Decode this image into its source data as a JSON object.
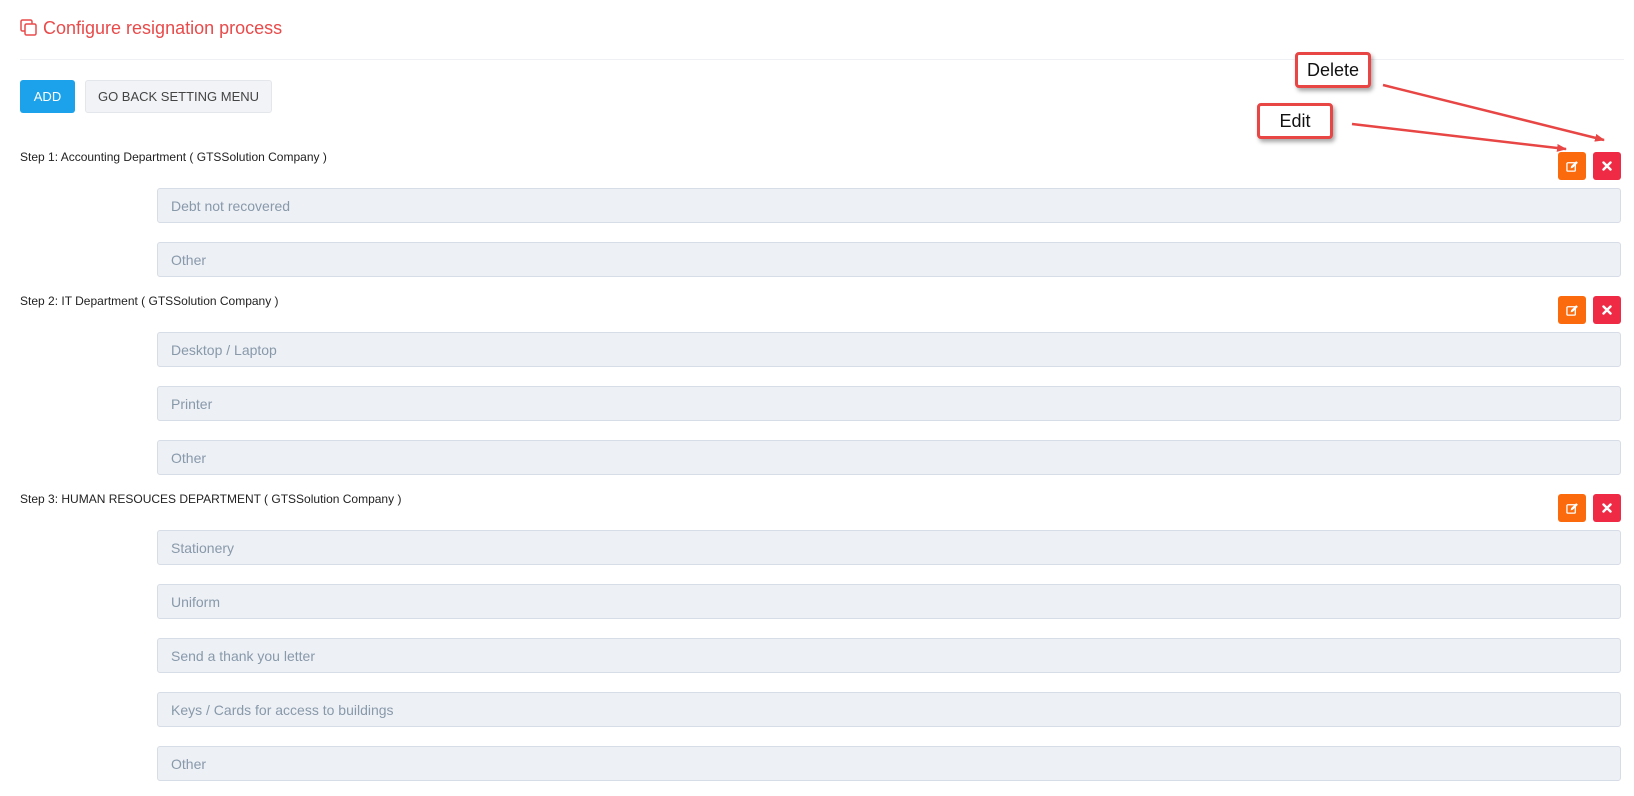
{
  "header": {
    "title": "Configure resignation process",
    "icon": "copy-icon",
    "title_color": "#e94a4a"
  },
  "toolbar": {
    "add_label": "ADD",
    "back_label": "GO BACK SETTING MENU",
    "add_color": "#1ba2eb"
  },
  "steps": [
    {
      "title": "Step 1: Accounting Department ( GTSSolution Company )",
      "items": [
        "Debt not recovered",
        "Other"
      ]
    },
    {
      "title": "Step 2: IT Department ( GTSSolution Company )",
      "items": [
        "Desktop / Laptop",
        "Printer",
        "Other"
      ]
    },
    {
      "title": "Step 3: HUMAN RESOUCES DEPARTMENT ( GTSSolution Company )",
      "items": [
        "Stationery",
        "Uniform",
        "Send a thank you letter",
        "Keys / Cards for access to buildings",
        "Other"
      ]
    }
  ],
  "actions": {
    "edit_icon": "edit-icon",
    "delete_icon": "close-icon",
    "edit_color": "#fb6b0d",
    "delete_color": "#ef2a45"
  },
  "annotations": {
    "delete_label": "Delete",
    "edit_label": "Edit",
    "border_color": "#e84545"
  }
}
